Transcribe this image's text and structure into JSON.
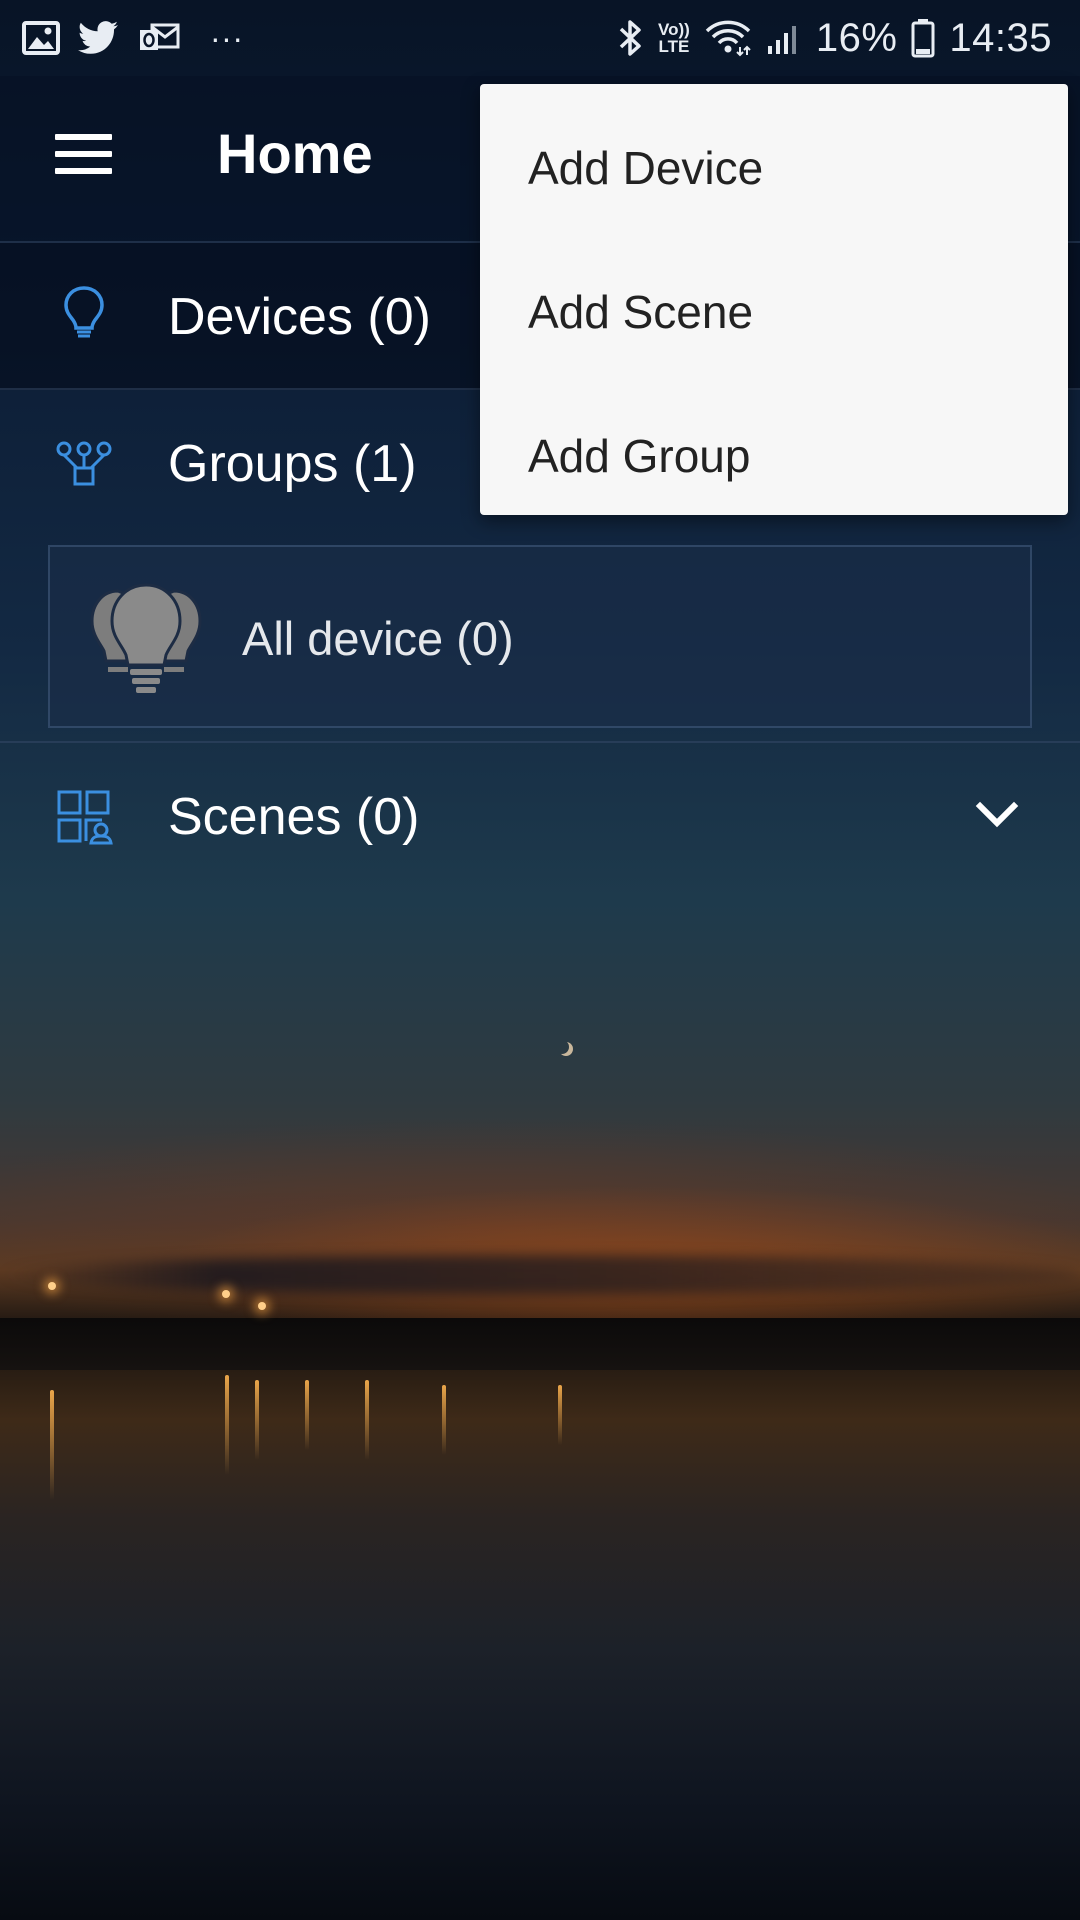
{
  "status_bar": {
    "left_icons": [
      "gallery-icon",
      "twitter-icon",
      "outlook-icon",
      "more-notifications-icon"
    ],
    "more_dots": "···",
    "right_icons": [
      "bluetooth-icon",
      "volte-icon",
      "wifi-icon",
      "cell-signal-icon",
      "battery-icon"
    ],
    "volte_label_top": "Vo))",
    "volte_label_bottom": "LTE",
    "battery_percent": "16%",
    "time": "14:35"
  },
  "app_bar": {
    "menu_icon": "hamburger-icon",
    "title": "Home"
  },
  "sections": {
    "devices": {
      "icon": "bulb-outline-icon",
      "label": "Devices (0)"
    },
    "groups": {
      "icon": "groups-icon",
      "label": "Groups (1)",
      "items": [
        {
          "icon": "group-bulbs-icon",
          "label": "All device (0)"
        }
      ]
    },
    "scenes": {
      "icon": "scenes-icon",
      "label": "Scenes (0)",
      "expand_icon": "chevron-down-icon"
    }
  },
  "popup_menu": {
    "items": [
      {
        "label": "Add Device"
      },
      {
        "label": "Add Scene"
      },
      {
        "label": "Add Group"
      }
    ]
  },
  "colors": {
    "accent_icon": "#3b8fe0",
    "menu_background": "#f7f7f7",
    "menu_text": "#222222",
    "text_primary": "#ffffff"
  }
}
